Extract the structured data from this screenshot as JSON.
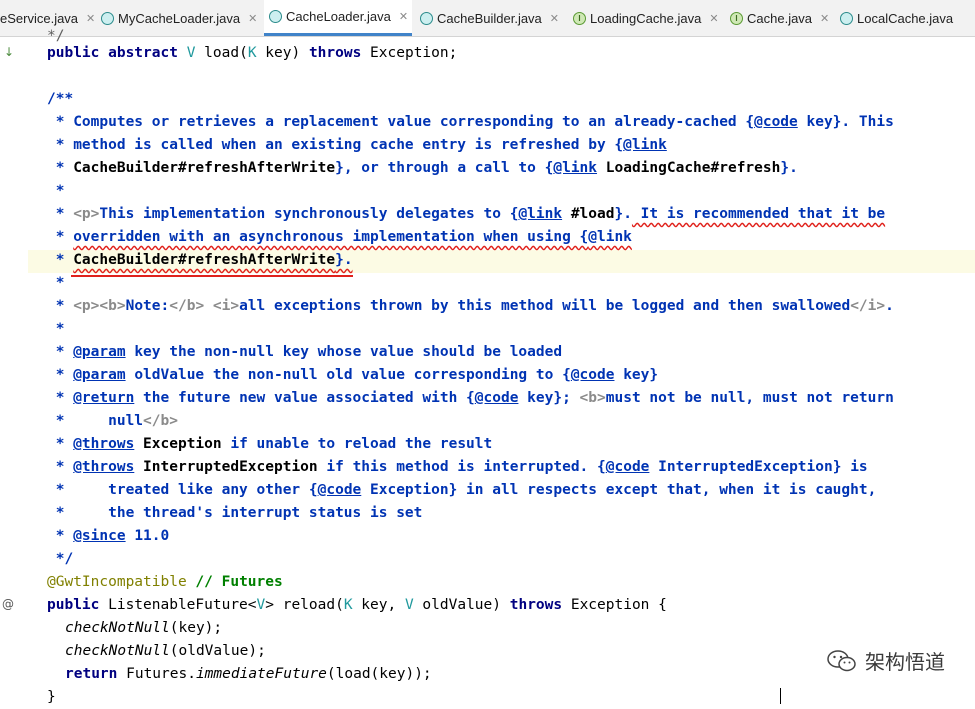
{
  "tabs": [
    {
      "label": "eService.java",
      "icon": "class-icon",
      "active": false
    },
    {
      "label": "MyCacheLoader.java",
      "icon": "class-icon",
      "active": false
    },
    {
      "label": "CacheLoader.java",
      "icon": "class-icon",
      "active": true
    },
    {
      "label": "CacheBuilder.java",
      "icon": "class-icon",
      "active": false
    },
    {
      "label": "LoadingCache.java",
      "icon": "interface-icon",
      "active": false
    },
    {
      "label": "Cache.java",
      "icon": "interface-icon",
      "active": false
    },
    {
      "label": "LocalCache.java",
      "icon": "class-icon",
      "active": false
    }
  ],
  "code": {
    "l0": "*/",
    "l1_kw1": "public abstract ",
    "l1_t": "V ",
    "l1_rest": "load(",
    "l1_k": "K ",
    "l1_rest2": "key) ",
    "l1_kw2": "throws ",
    "l1_rest3": "Exception;",
    "l3": "/**",
    "l4a": " * Computes or retrieves a replacement value corresponding to an already-cached {",
    "l4tag": "@code",
    "l4b": " key}. This",
    "l5a": " * method is called when an existing cache entry is refreshed by {",
    "l5tag": "@link",
    "l6a": " * ",
    "l6b": "CacheBuilder#refreshAfterWrite",
    "l6c": "}, or through a call to {",
    "l6tag": "@link",
    "l6d": " ",
    "l6e": "LoadingCache#refresh",
    "l6f": "}.",
    "l7": " *",
    "l8a": " * ",
    "l8p": "<p>",
    "l8b": "This implementation synchronously delegates to {",
    "l8tag": "@link",
    "l8c": " ",
    "l8d": "#load",
    "l8e": "}.",
    "l8f": " It is recommended that it be",
    "l9a": " * ",
    "l9b": "overridden with an asynchronous implementation when using {",
    "l9tag": "@link",
    "l10a": " * ",
    "l10b": "CacheBuilder#refreshAfterWrite",
    "l10c": "}.",
    "l11": " *",
    "l12a": " * ",
    "l12p": "<p><b>",
    "l12b": "Note:",
    "l12c": "</b> <i>",
    "l12d": "all exceptions thrown by this method will be logged and then swallowed",
    "l12e": "</i>",
    "l12f": ".",
    "l13": " *",
    "l14a": " * ",
    "l14tag": "@param",
    "l14b": " key the non-null key whose value should be loaded",
    "l15a": " * ",
    "l15tag": "@param",
    "l15b": " oldValue the non-null old value corresponding to {",
    "l15tag2": "@code",
    "l15c": " key}",
    "l16a": " * ",
    "l16tag": "@return",
    "l16b": " the future new value associated with {",
    "l16tag2": "@code",
    "l16c": " key}; ",
    "l16d": "<b>",
    "l16e": "must not be null, must not return",
    "l17a": " *     null",
    "l17b": "</b>",
    "l18a": " * ",
    "l18tag": "@throws",
    "l18b": " ",
    "l18c": "Exception",
    "l18d": " if unable to reload the result",
    "l19a": " * ",
    "l19tag": "@throws",
    "l19b": " ",
    "l19c": "InterruptedException",
    "l19d": " if this method is interrupted. {",
    "l19tag2": "@code",
    "l19e": " InterruptedException} is",
    "l20a": " *     treated like any other {",
    "l20tag": "@code",
    "l20b": " Exception} in all respects except that, when it is caught,",
    "l21": " *     the thread's interrupt status is set",
    "l22a": " * ",
    "l22tag": "@since",
    "l22b": " 11.0",
    "l23": " */",
    "l24a": "@GwtIncompatible",
    "l24b": " // ",
    "l24c": "Futures",
    "l25_kw": "public ",
    "l25a": "ListenableFuture<",
    "l25t": "V",
    "l25b": "> reload(",
    "l25k": "K ",
    "l25c": "key, ",
    "l25v": "V ",
    "l25d": "oldValue) ",
    "l25kw2": "throws ",
    "l25e": "Exception {",
    "l26a": "checkNotNull",
    "l26b": "(key);",
    "l27a": "checkNotNull",
    "l27b": "(oldValue);",
    "l28kw": "return ",
    "l28a": "Futures.",
    "l28b": "immediateFuture",
    "l28c": "(load(key));",
    "l29": "}"
  },
  "watermark": {
    "text": "架构悟道",
    "icon": "wechat-icon"
  }
}
